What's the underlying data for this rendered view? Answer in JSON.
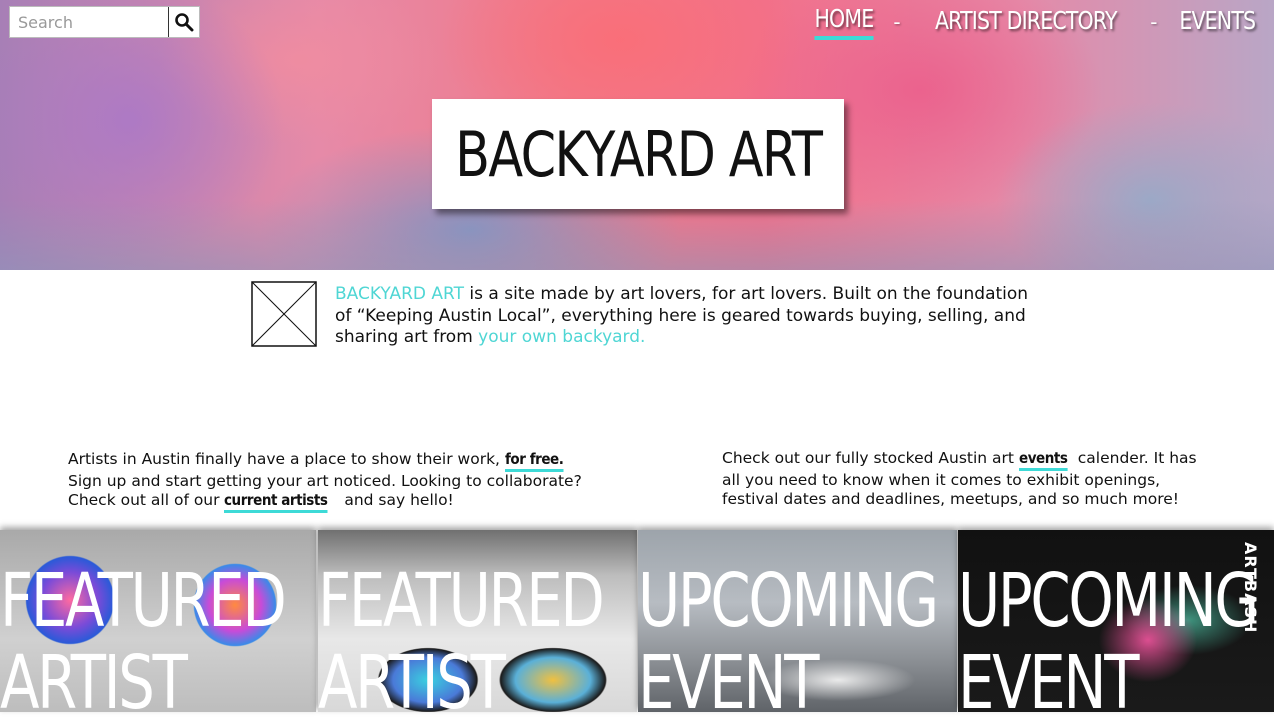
{
  "search": {
    "placeholder": "Search",
    "button_icon": "search-icon"
  },
  "nav": {
    "items": [
      {
        "label": "HOME",
        "active": true
      },
      {
        "label": "ARTIST DIRECTORY",
        "active": false
      },
      {
        "label": "EVENTS",
        "active": false
      }
    ],
    "separator": "-"
  },
  "hero": {
    "title": "BACKYARD ART"
  },
  "intro": {
    "brand": "BACKYARD ART",
    "text_1": " is a site made by art lovers, for art lovers. Built on the foundation of “Keeping Austin Local”, everything here is geared towards buying, selling, and sharing art from ",
    "link": "your own backyard."
  },
  "left_column": {
    "text_1": "Artists in Austin finally have a place to show their work, ",
    "link_1": "for free.",
    "text_2": " Sign up and start getting your art noticed. Looking to collaborate? Check out all of our ",
    "link_2": "current artists",
    "text_3": " and say hello!"
  },
  "right_column": {
    "text_1": "Check out our fully stocked Austin art ",
    "link_1": "events",
    "text_2": " calender. It has all you need to know when it comes to exhibit openings, festival dates and deadlines, meetups, and so much more!"
  },
  "cards": [
    {
      "line_1": "FEATURED",
      "line_2": "ARTIST"
    },
    {
      "line_1": "FEATURED",
      "line_2": "ARTIST"
    },
    {
      "line_1": "UPCOMING",
      "line_2": "EVENT"
    },
    {
      "line_1": "UPCOMING",
      "line_2": "EVENT",
      "image_text": "ARTBASH"
    }
  ],
  "colors": {
    "accent": "#3ddad7",
    "accent_text": "#4fd6d4"
  }
}
